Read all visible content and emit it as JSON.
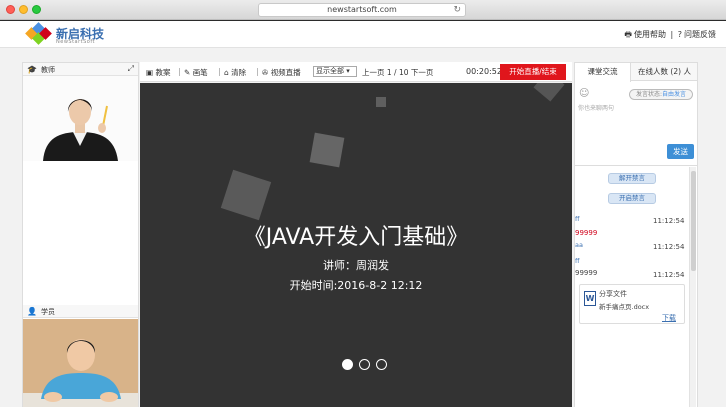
{
  "browser": {
    "url": "newstartsoft.com"
  },
  "header": {
    "brand_name": "新启科技",
    "brand_sub": "NewStartSoft",
    "help_label": "使用帮助",
    "separator": "|",
    "feedback_label": "问题反馈"
  },
  "left": {
    "teacher_label": "教师",
    "student_label": "学员"
  },
  "toolbar": {
    "courseware": "教案",
    "pen": "画笔",
    "clear": "清除",
    "video_live": "视频直播",
    "display_select": "显示全部",
    "pager": "上一页 1 / 10 下一页",
    "timer": "00:20:52",
    "live_button": "开始直播/结束"
  },
  "slide": {
    "title": "《JAVA开发入门基础》",
    "lecturer": "讲师：周润发",
    "start_time": "开始时间:2016-8-2 12:12",
    "total_dots": 3,
    "active_dot": 1
  },
  "right": {
    "tab_chat": "课堂交流",
    "tab_online": "在线人数 (2) 人",
    "placeholder": "你也来聊两句",
    "status_prefix": "发言状态:",
    "status_value": "自由发言",
    "send_label": "发送",
    "unmute_label": "解开禁言",
    "mute_label": "开启禁言",
    "messages": [
      {
        "name": "ff",
        "color": "#3a6fb0",
        "time": "11:12:54",
        "text": "99999",
        "text_color": "#d0021b"
      },
      {
        "name": "aa",
        "color": "#3a6fb0",
        "time": "11:12:54",
        "text": "",
        "text_color": "#444"
      },
      {
        "name": "ff",
        "color": "#3a6fb0",
        "time": "11:12:54",
        "text": "99999",
        "text_color": "#444"
      }
    ],
    "file_title": "分享文件",
    "file_name": "新手痛点页.docx",
    "download_label": "下载"
  },
  "colors": {
    "accent": "#3d8fd6",
    "live_red": "#e0161c",
    "slide_bg": "#333333"
  }
}
